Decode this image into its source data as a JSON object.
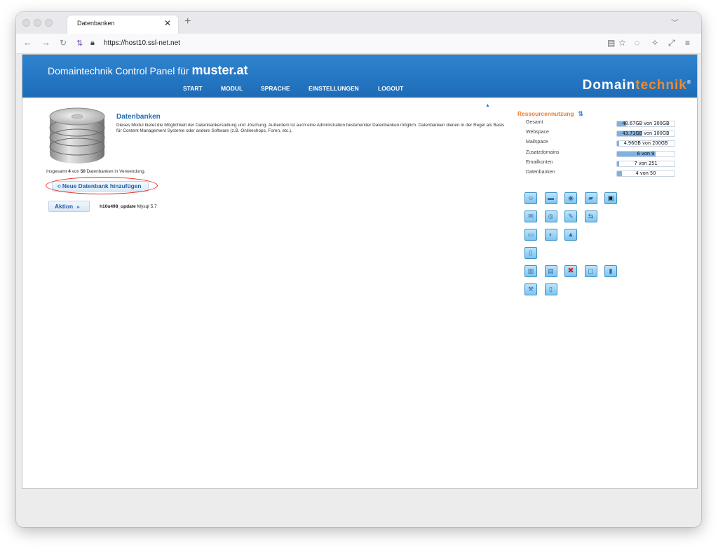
{
  "browser": {
    "tab_title": "Datenbanken",
    "tab_close": "✕",
    "new_tab": "+",
    "url_host": "host10.ssl-net.net",
    "url_scheme": "https://"
  },
  "header": {
    "panel_title_prefix": "Domaintechnik Control Panel für",
    "domain": "muster.at",
    "menu": [
      "START",
      "MODUL",
      "SPRACHE",
      "EINSTELLUNGEN",
      "LOGOUT"
    ],
    "logo_main": "Domain",
    "logo_accent": "technik",
    "logo_mark": "®"
  },
  "module": {
    "title": "Datenbanken",
    "description": "Dieses Modul bietet die Möglichkeit der Datenbankerstellung und -löschung. Außerdem ist auch eine Administration bestehender Datenbanken möglich. Datenbanken dienen in der Regel als Basis für Content Management Systeme oder andere Software (z.B. Onlineshops, Foren, etc.).",
    "usage_prefix": "Insgesamt",
    "usage_used": "4",
    "usage_mid": "von",
    "usage_total": "50",
    "usage_suffix": "Datenbanken in Verwendung.",
    "add_button": "Neue Datenbank hinzufügen",
    "action_button": "Aktion",
    "entries": [
      {
        "name": "h10u498_update",
        "type": "Mysql",
        "version": "5.7"
      }
    ]
  },
  "resources": {
    "title": "Ressourcennutzung",
    "items": [
      {
        "label": "Gesamt",
        "text": "48.67GB von 300GB",
        "fraction": 0.16
      },
      {
        "label": "Webspace",
        "text": "43.71GB von 100GB",
        "fraction": 0.44
      },
      {
        "label": "Mailspace",
        "text": "4.96GB von 200GB",
        "fraction": 0.025
      },
      {
        "label": "Zusatzdomains",
        "text": "6 von 9",
        "fraction": 0.67
      },
      {
        "label": "Emailkonten",
        "text": "7 von 251",
        "fraction": 0.03
      },
      {
        "label": "Datenbanken",
        "text": "4 von 50",
        "fraction": 0.08
      }
    ]
  },
  "quick_icons": [
    [
      "user-icon",
      "folder-icon",
      "database-icon",
      "folder-open-icon",
      "terminal-icon"
    ],
    [
      "mail-icon",
      "bulb-icon",
      "envelope-icon",
      "transfer-icon"
    ],
    [
      "monitor-icon",
      "globe-icon",
      "lock-icon"
    ],
    [
      "document-icon"
    ],
    [
      "server-icon",
      "film-icon",
      "delete-icon",
      "page-icon",
      "chart-icon"
    ],
    [
      "tools-icon",
      "notes-icon"
    ]
  ],
  "colors": {
    "banner": "#1e6cb8",
    "accent": "#f08a2c",
    "link": "#1e6cb8",
    "bar_fill": "#7fb2e0",
    "highlight": "#e02a1a"
  }
}
